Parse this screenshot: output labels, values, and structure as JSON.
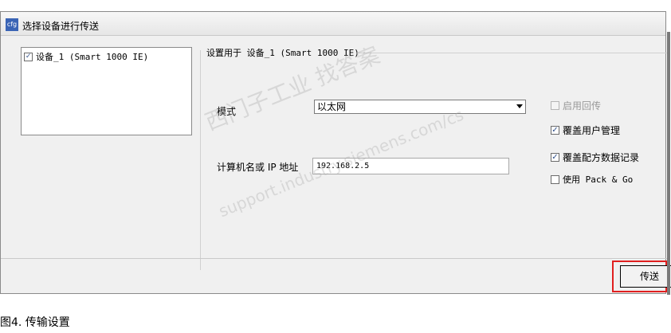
{
  "window": {
    "icon_text": "cfg",
    "title": "选择设备进行传送"
  },
  "device_list": {
    "items": [
      {
        "label": "设备_1 (Smart 1000 IE)",
        "checked": true
      }
    ]
  },
  "settings": {
    "header": "设置用于 设备_1 (Smart 1000 IE)",
    "mode_label": "模式",
    "mode_value": "以太网",
    "address_label": "计算机名或 IP 地址",
    "address_value": "192.168.2.5"
  },
  "options": [
    {
      "label": "启用回传",
      "checked": false,
      "enabled": false
    },
    {
      "label": "覆盖用户管理",
      "checked": true,
      "enabled": true
    },
    {
      "label": "覆盖配方数据记录",
      "checked": true,
      "enabled": true
    },
    {
      "label": "使用 Pack & Go",
      "checked": false,
      "enabled": true
    }
  ],
  "buttons": {
    "send": "传送"
  },
  "watermark": {
    "line1": "西门子工业  找答案",
    "line2": "support.industry.siemens.com/cs"
  },
  "caption": "图4. 传输设置",
  "colors": {
    "highlight_border": "#e01f1f",
    "title_icon_bg": "#3a64b5"
  }
}
